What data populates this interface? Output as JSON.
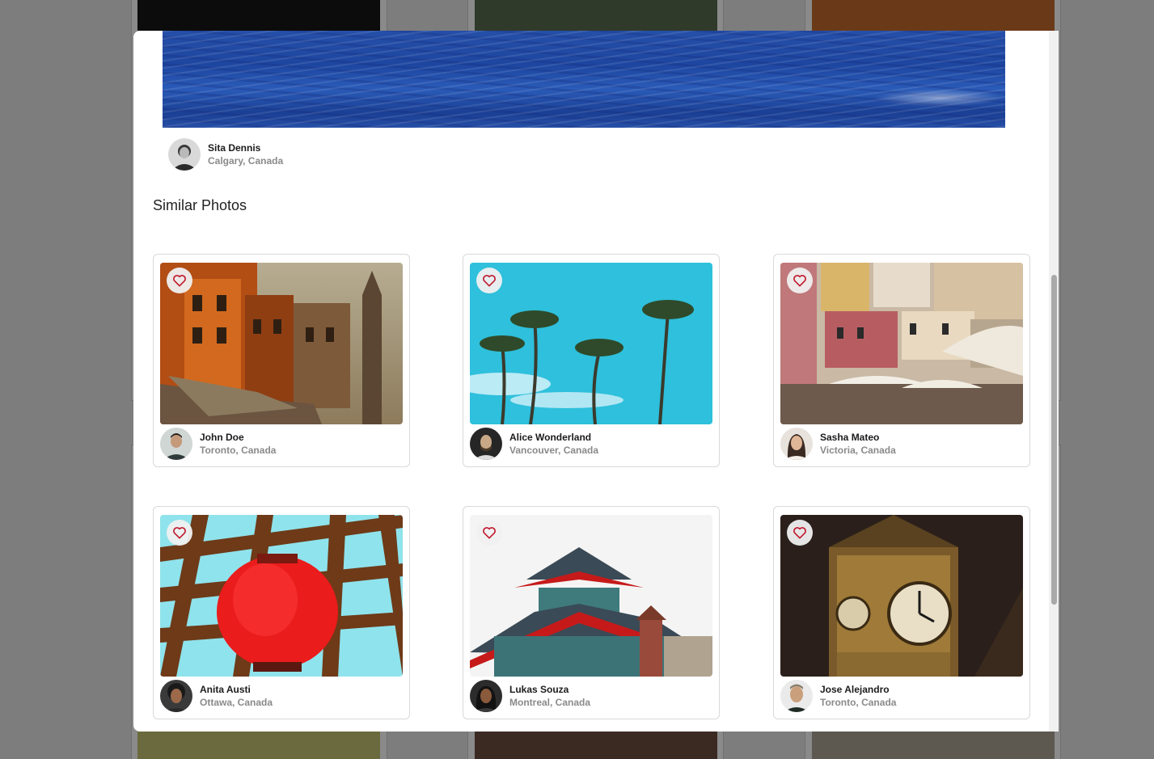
{
  "modal": {
    "main_photo": {
      "author_name": "Sita Dennis",
      "author_location": "Calgary, Canada"
    },
    "similar_title": "Similar Photos",
    "similar_photos": [
      {
        "author_name": "John Doe",
        "author_location": "Toronto, Canada",
        "subject": "street-buildings"
      },
      {
        "author_name": "Alice Wonderland",
        "author_location": "Vancouver, Canada",
        "subject": "palm-trees"
      },
      {
        "author_name": "Sasha Mateo",
        "author_location": "Victoria, Canada",
        "subject": "colorful-town"
      },
      {
        "author_name": "Anita Austi",
        "author_location": "Ottawa, Canada",
        "subject": "red-lantern"
      },
      {
        "author_name": "Lukas Souza",
        "author_location": "Montreal, Canada",
        "subject": "pagoda"
      },
      {
        "author_name": "Jose Alejandro",
        "author_location": "Toronto, Canada",
        "subject": "clock-tower"
      }
    ]
  },
  "icons": {
    "favorite": "heart-icon"
  },
  "colors": {
    "heart": "#c0192e",
    "title": "#222222",
    "location": "#8a8a8a"
  }
}
